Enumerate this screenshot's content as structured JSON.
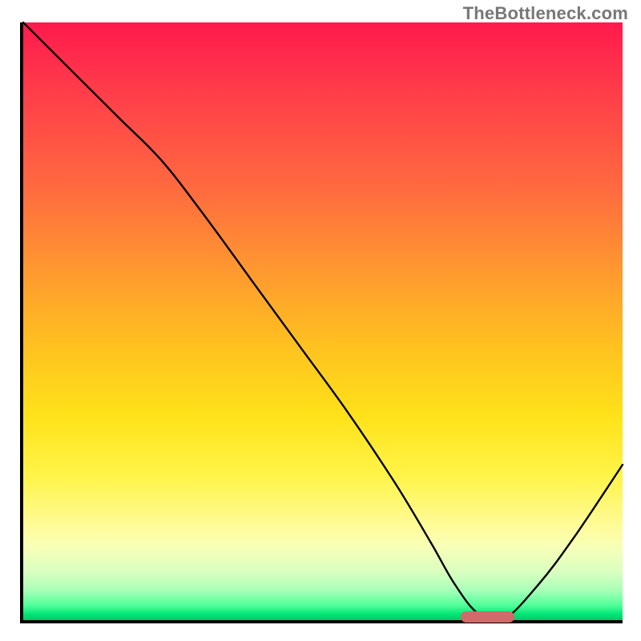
{
  "watermark": "TheBottleneck.com",
  "chart_data": {
    "type": "line",
    "title": "",
    "xlabel": "",
    "ylabel": "",
    "xlim": [
      0,
      100
    ],
    "ylim": [
      0,
      100
    ],
    "grid": false,
    "legend": false,
    "background_gradient": {
      "top_color": "#ff1a4d",
      "mid_color": "#ffe21a",
      "bottom_color": "#00c86a"
    },
    "series": [
      {
        "name": "bottleneck-curve",
        "color": "#000000",
        "x": [
          0,
          8,
          16,
          23,
          30,
          38,
          46,
          54,
          62,
          68,
          72,
          76,
          80,
          86,
          92,
          100
        ],
        "values": [
          100,
          92,
          84,
          77,
          68,
          57,
          46,
          35,
          23,
          13,
          6,
          1,
          0,
          6,
          14,
          26
        ]
      }
    ],
    "optimal_marker": {
      "x_start": 73,
      "x_end": 82,
      "y": 0.5,
      "color": "#d16a6a"
    }
  }
}
